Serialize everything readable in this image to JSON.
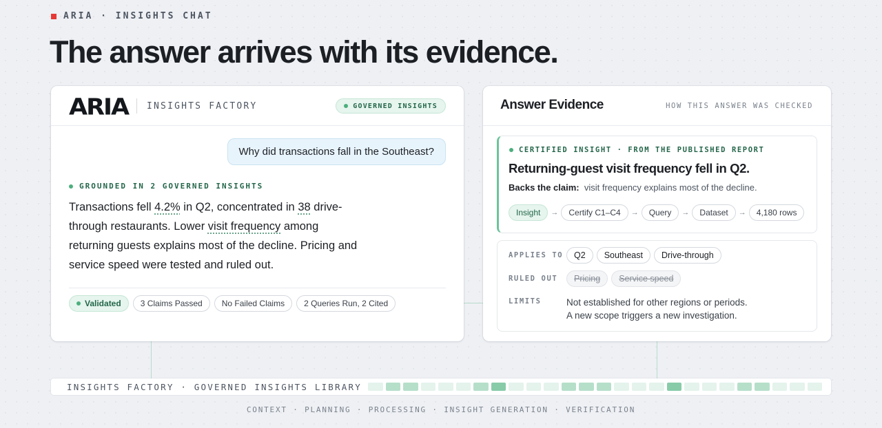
{
  "eyebrow": "ARIA · INSIGHTS CHAT",
  "headline": "The answer arrives with its evidence.",
  "chat": {
    "logo": "ARIA",
    "product": "INSIGHTS FACTORY",
    "governed_badge": "GOVERNED INSIGHTS",
    "question": "Why did transactions fall in the Southeast?",
    "grounded_label": "GROUNDED IN 2 GOVERNED INSIGHTS",
    "answer": {
      "p1": "Transactions fell ",
      "u1": "4.2%",
      "p2": " in Q2, concentrated in ",
      "u2": "38",
      "p3": " drive-through restaurants. Lower ",
      "u3": "visit frequency",
      "p4": " among returning guests explains most of the decline. Pricing and service speed were tested and ruled out."
    },
    "chips": {
      "validated": "Validated",
      "claims": "3 Claims Passed",
      "failed": "No Failed Claims",
      "queries": "2 Queries Run, 2 Cited"
    }
  },
  "evidence": {
    "title": "Answer Evidence",
    "subtitle": "HOW THIS ANSWER WAS CHECKED",
    "certified_label": "CERTIFIED INSIGHT · FROM THE PUBLISHED REPORT",
    "insight_title": "Returning-guest visit frequency fell in Q2.",
    "backs_label": "Backs the claim:",
    "backs_text": "visit frequency explains most of the decline.",
    "lineage": [
      "Insight",
      "Certify C1–C4",
      "Query",
      "Dataset",
      "4,180 rows"
    ],
    "applies_label": "APPLIES TO",
    "applies": [
      "Q2",
      "Southeast",
      "Drive-through"
    ],
    "ruled_label": "RULED OUT",
    "ruled": [
      "Pricing",
      "Service speed"
    ],
    "limits_label": "LIMITS",
    "limits": [
      "Not established for other regions or periods.",
      "A new scope triggers a new investigation."
    ]
  },
  "library": {
    "label": "INSIGHTS FACTORY · GOVERNED INSIGHTS LIBRARY",
    "cells": [
      1,
      2,
      2,
      1,
      1,
      1,
      2,
      3,
      1,
      1,
      1,
      2,
      2,
      2,
      1,
      1,
      1,
      3,
      1,
      1,
      1,
      2,
      2,
      1,
      1,
      1
    ]
  },
  "stages": "CONTEXT · PLANNING · PROCESSING · INSIGHT GENERATION · VERIFICATION",
  "colors": {
    "accent_green": "#4caf7d",
    "eyebrow_red": "#e53935",
    "chip_green_bg": "#e6f5ee"
  }
}
